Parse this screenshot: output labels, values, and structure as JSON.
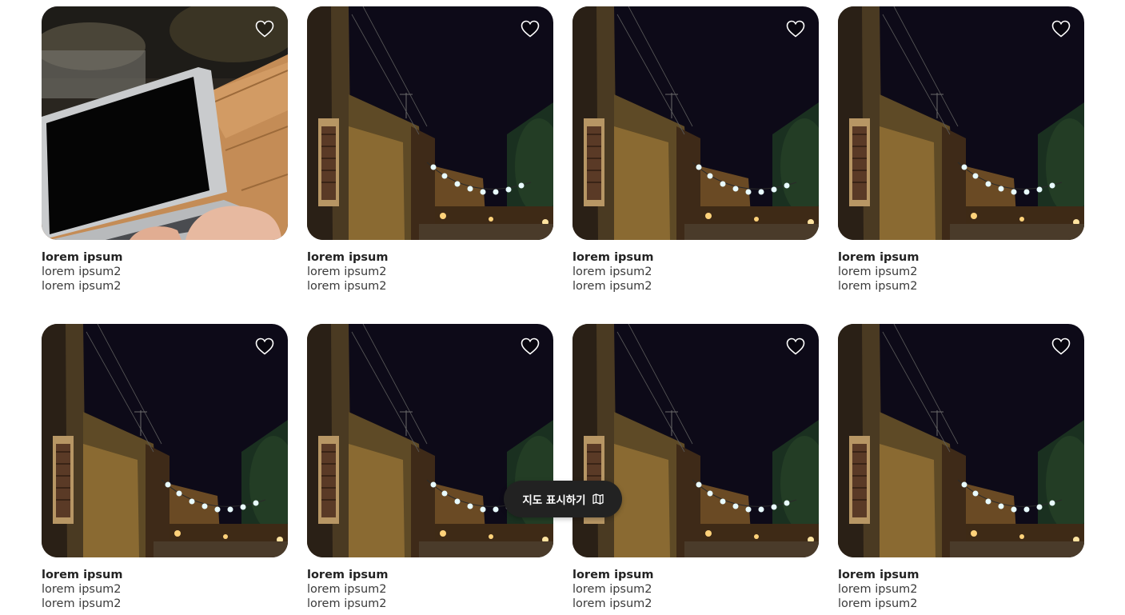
{
  "listings": [
    {
      "image": "laptop-on-wooden-table-photo",
      "title": "lorem ipsum",
      "line1": "lorem ipsum2",
      "line2": "lorem ipsum2"
    },
    {
      "image": "night-street-lanterns-photo",
      "title": "lorem ipsum",
      "line1": "lorem ipsum2",
      "line2": "lorem ipsum2"
    },
    {
      "image": "night-street-lanterns-photo",
      "title": "lorem ipsum",
      "line1": "lorem ipsum2",
      "line2": "lorem ipsum2"
    },
    {
      "image": "night-street-lanterns-photo",
      "title": "lorem ipsum",
      "line1": "lorem ipsum2",
      "line2": "lorem ipsum2"
    },
    {
      "image": "night-street-lanterns-photo",
      "title": "lorem ipsum",
      "line1": "lorem ipsum2",
      "line2": "lorem ipsum2"
    },
    {
      "image": "night-street-lanterns-photo",
      "title": "lorem ipsum",
      "line1": "lorem ipsum2",
      "line2": "lorem ipsum2"
    },
    {
      "image": "night-street-lanterns-photo",
      "title": "lorem ipsum",
      "line1": "lorem ipsum2",
      "line2": "lorem ipsum2"
    },
    {
      "image": "night-street-lanterns-photo",
      "title": "lorem ipsum",
      "line1": "lorem ipsum2",
      "line2": "lorem ipsum2"
    }
  ],
  "map_button": {
    "label": "지도 표시하기",
    "icon": "map-icon"
  },
  "colors": {
    "button_bg": "#222222",
    "title_text": "#222222",
    "heart_stroke": "#ffffff"
  }
}
